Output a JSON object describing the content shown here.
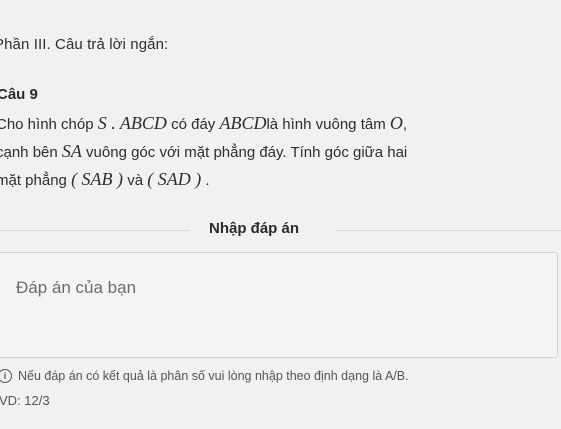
{
  "section": {
    "title": "Phần III. Câu trả lời ngắn:"
  },
  "question": {
    "label": "Câu 9",
    "line1_pre": "Cho hình chóp ",
    "line1_math1": "S . ABCD",
    "line1_mid": " có đáy ",
    "line1_math2": "ABCD",
    "line1_post": "là hình vuông tâm ",
    "line1_math3": "O",
    "line1_end": ",",
    "line2_pre": "cạnh bên ",
    "line2_math": "SA",
    "line2_post": " vuông góc với mặt phẳng đáy. Tính góc giữa hai",
    "line3_pre": "mặt phẳng ",
    "line3_math1": "( SAB )",
    "line3_mid": " và ",
    "line3_math2": "( SAD )",
    "line3_end": " ."
  },
  "answer_section": {
    "header": "Nhập đáp án",
    "placeholder": "Đáp án của bạn"
  },
  "note": {
    "icon": "info-icon",
    "text": "Nếu đáp án có kết quả là phân số vui lòng nhập theo định dạng là A/B.",
    "example": "VD: 12/3"
  }
}
